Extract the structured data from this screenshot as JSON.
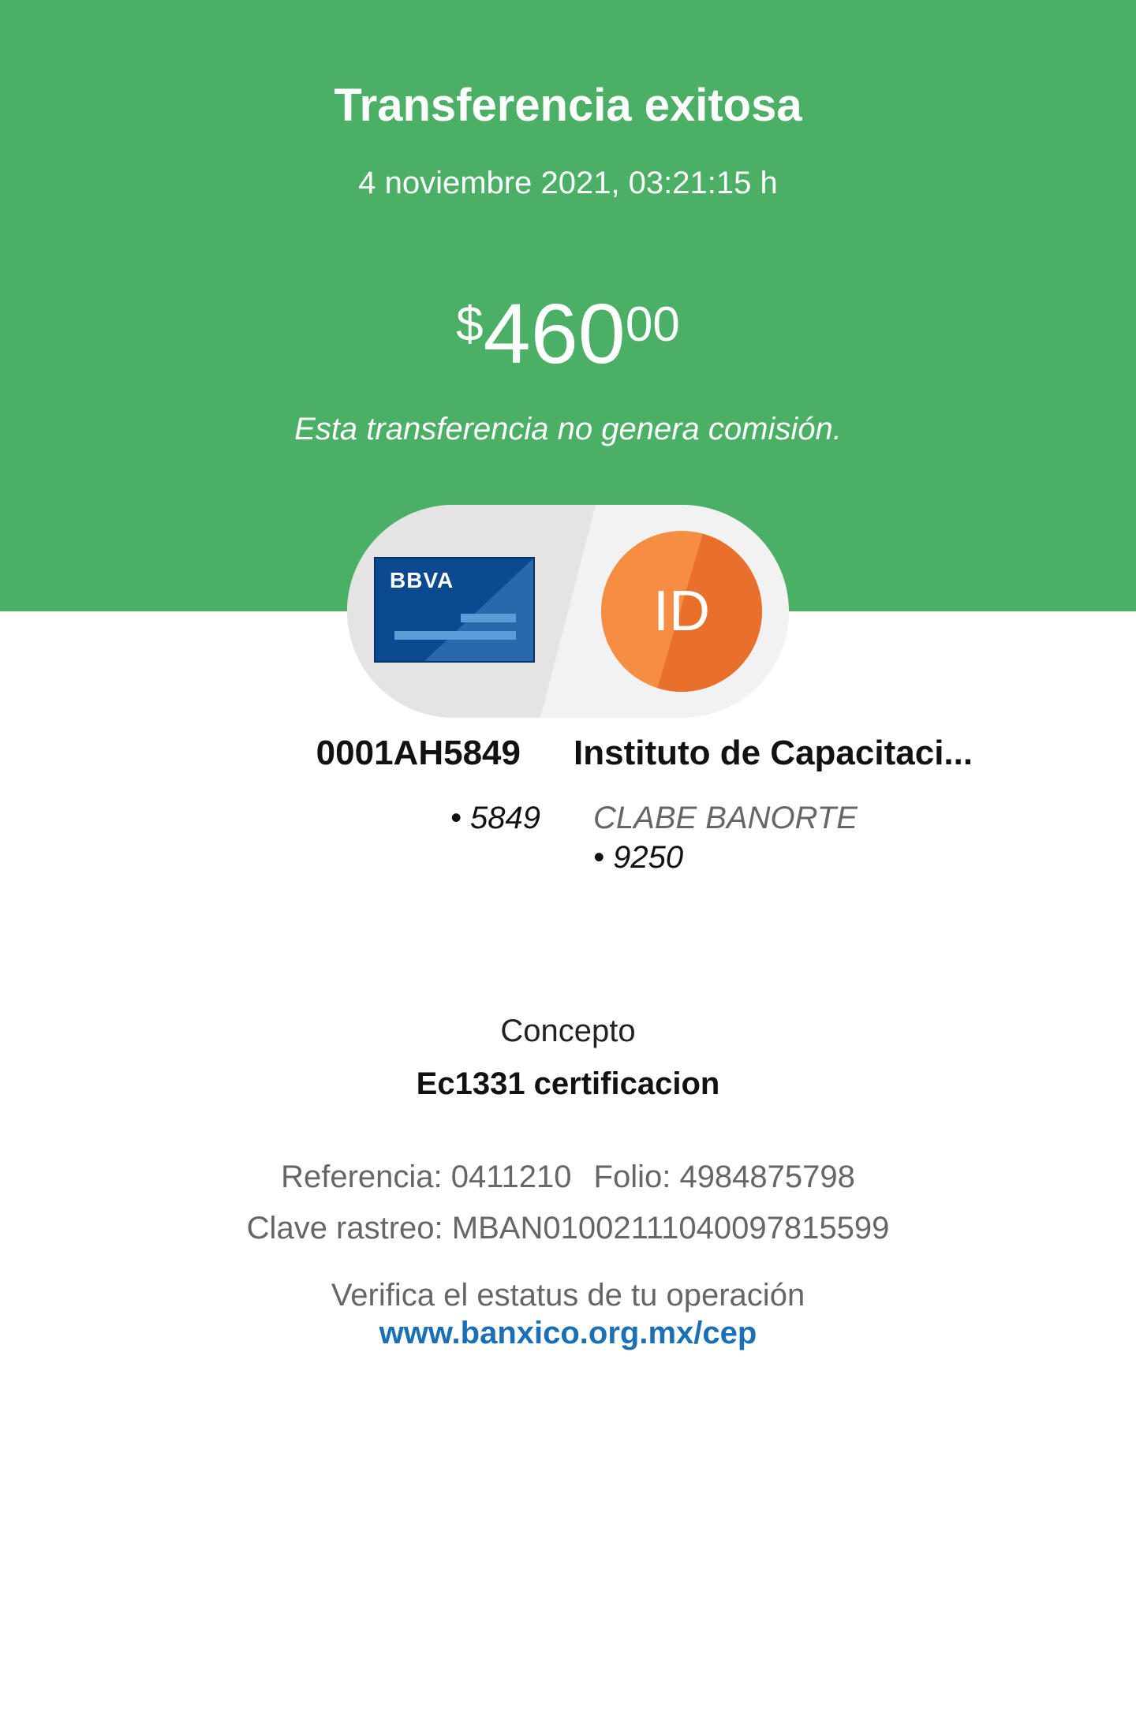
{
  "header": {
    "title": "Transferencia exitosa",
    "datetime": "4 noviembre 2021, 03:21:15 h",
    "background_color": "#4CAF66"
  },
  "amount": {
    "currency_symbol": "$",
    "integer": "460",
    "decimals": "00"
  },
  "fee_note": "Esta transferencia no genera comisión.",
  "origin": {
    "bank_logo_text": "BBVA",
    "icon": "bank-card-icon",
    "card_color": "#0B4A90",
    "name": "0001AH5849",
    "account": "• 5849"
  },
  "destination": {
    "avatar_initials": "ID",
    "avatar_color": "#F58D42",
    "name": "Instituto de Capacitaci...",
    "account_type": "CLABE BANORTE",
    "account": "• 9250"
  },
  "concept": {
    "label": "Concepto",
    "value": "Ec1331 certificacion"
  },
  "details": {
    "reference": "Referencia: 0411210",
    "folio": "Folio: 4984875798",
    "tracking": "Clave rastreo: MBAN01002111040097815599"
  },
  "verify": {
    "text": "Verifica el estatus de tu operación",
    "link": "www.banxico.org.mx/cep",
    "link_color": "#1B6FB5"
  }
}
